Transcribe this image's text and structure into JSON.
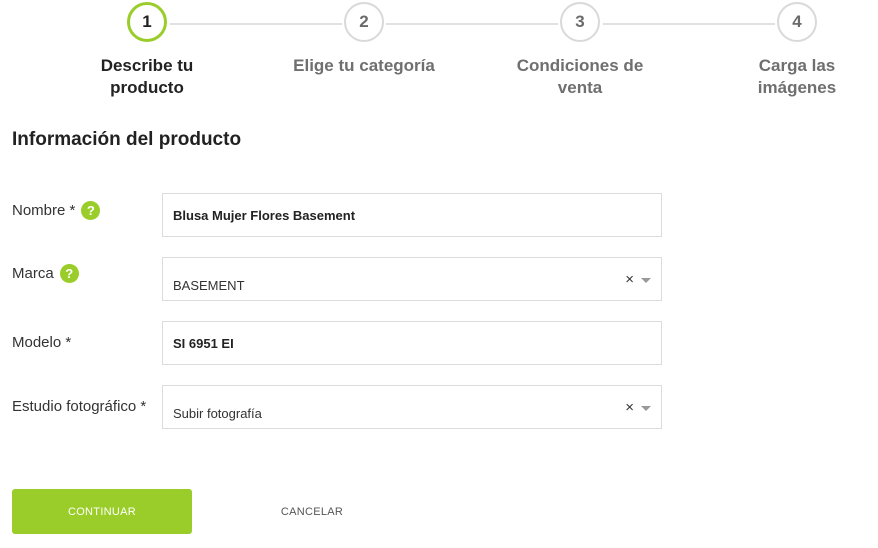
{
  "stepper": {
    "steps": [
      {
        "number": "1",
        "label_line1": "Describe tu",
        "label_line2": "producto",
        "active": true
      },
      {
        "number": "2",
        "label_line1": "Elige tu categoría",
        "label_line2": "",
        "active": false
      },
      {
        "number": "3",
        "label_line1": "Condiciones de",
        "label_line2": "venta",
        "active": false
      },
      {
        "number": "4",
        "label_line1": "Carga las",
        "label_line2": "imágenes",
        "active": false
      }
    ]
  },
  "section": {
    "title": "Información del producto"
  },
  "form": {
    "nombre": {
      "label": "Nombre *",
      "value": "Blusa Mujer Flores Basement",
      "help_icon": "question-icon"
    },
    "marca": {
      "label": "Marca",
      "value": "BASEMENT",
      "help_icon": "question-icon",
      "clear_glyph": "×"
    },
    "modelo": {
      "label": "Modelo *",
      "value": "SI 6951 EI"
    },
    "estudio": {
      "label": "Estudio fotográfico *",
      "value": "Subir fotografía",
      "clear_glyph": "×"
    }
  },
  "actions": {
    "continue_label": "CONTINUAR",
    "cancel_label": "CANCELAR"
  },
  "colors": {
    "accent": "#9acd2a",
    "inactive_step": "#d9d9d9",
    "field_border": "#dcdcdc"
  }
}
